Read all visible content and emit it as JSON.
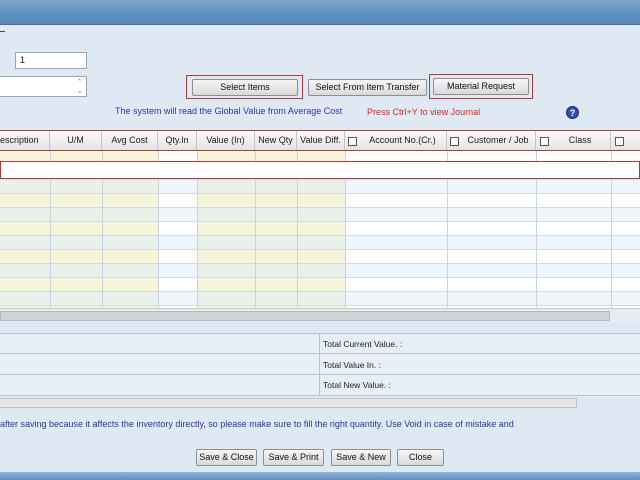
{
  "form": {
    "field1_value": "1",
    "buttons": {
      "select_items": "Select Items",
      "select_from_transfer": "Select From Item Transfer",
      "material_request": "Material Request"
    },
    "info_global": "The system will read the Global Value from Average Cost",
    "info_journal": "Press Ctrl+Y to view Journal",
    "help_icon": "?"
  },
  "grid": {
    "columns": [
      "escription",
      "U/M",
      "Avg Cost",
      "Qty.In",
      "Value (In)",
      "New Qty",
      "Value Diff.",
      "Account No.(Cr.)",
      "Customer / Job",
      "Class"
    ]
  },
  "totals": {
    "current_value_label": "Total Current Value. :",
    "value_in_label": "Total Value In. :",
    "new_value_label": "Total New Value. :"
  },
  "warning_text": "after saving because it affects the inventory directly, so please make sure to fill the right quantity. Use Void in case of mistake and",
  "footer": {
    "save_close": "Save & Close",
    "save_print": "Save & Print",
    "save_new": "Save & New",
    "close": "Close"
  },
  "colors": {
    "highlight_border": "#b33a3a",
    "info_blue": "#2f36a8",
    "info_red": "#e0261f",
    "editable_column": "#f6f4d9"
  }
}
